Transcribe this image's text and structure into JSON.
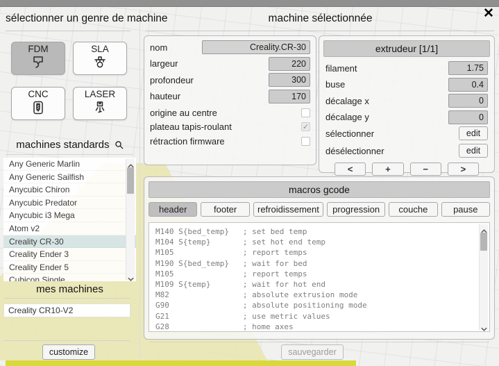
{
  "dialog": {
    "left_title": "sélectionner un genre de machine",
    "right_title": "machine sélectionnée",
    "close_icon": "✕"
  },
  "machine_types": [
    {
      "label": "FDM",
      "selected": true
    },
    {
      "label": "SLA",
      "selected": false
    },
    {
      "label": "CNC",
      "selected": false
    },
    {
      "label": "LASER",
      "selected": false
    }
  ],
  "standards": {
    "title": "machines standards",
    "items": [
      {
        "label": "Any Generic Marlin",
        "selected": false
      },
      {
        "label": "Any Generic Sailfish",
        "selected": false
      },
      {
        "label": "Anycubic Chiron",
        "selected": false
      },
      {
        "label": "Anycubic Predator",
        "selected": false
      },
      {
        "label": "Anycubic i3 Mega",
        "selected": false
      },
      {
        "label": "Atom v2",
        "selected": false
      },
      {
        "label": "Creality CR-30",
        "selected": true
      },
      {
        "label": "Creality Ender 3",
        "selected": false
      },
      {
        "label": "Creality Ender 5",
        "selected": false
      },
      {
        "label": "Cubicon Single",
        "selected": false
      }
    ]
  },
  "my_machines": {
    "title": "mes machines",
    "machine_name": "Creality CR10-V2"
  },
  "settings": {
    "name_label": "nom",
    "name_value": "Creality.CR-30",
    "width_label": "largeur",
    "width_value": "220",
    "depth_label": "profondeur",
    "depth_value": "300",
    "height_label": "hauteur",
    "height_value": "170",
    "origin_center_label": "origine au centre",
    "origin_center_checked": false,
    "belt_label": "plateau tapis-roulant",
    "belt_checked": true,
    "belt_disabled": true,
    "retract_label": "rétraction firmware",
    "retract_checked": false
  },
  "extruder": {
    "title": "extrudeur [1/1]",
    "filament_label": "filament",
    "filament_value": "1.75",
    "nozzle_label": "buse",
    "nozzle_value": "0.4",
    "offset_x_label": "décalage x",
    "offset_x_value": "0",
    "offset_y_label": "décalage y",
    "offset_y_value": "0",
    "select_label": "sélectionner",
    "select_button": "edit",
    "deselect_label": "désélectionner",
    "deselect_button": "edit",
    "nav": {
      "prev": "<",
      "add": "+",
      "remove": "−",
      "next": ">"
    }
  },
  "macros": {
    "title": "macros gcode",
    "tabs": [
      {
        "label": "header",
        "selected": true
      },
      {
        "label": "footer",
        "selected": false
      },
      {
        "label": "refroidissement",
        "selected": false
      },
      {
        "label": "progression",
        "selected": false
      },
      {
        "label": "couche",
        "selected": false
      },
      {
        "label": "pause",
        "selected": false
      }
    ],
    "code": "M140 S{bed_temp}   ; set bed temp\nM104 S{temp}       ; set hot end temp\nM105               ; report temps\nM190 S{bed_temp}   ; wait for bed\nM105               ; report temps\nM109 S{temp}       ; wait for hot end\nM82                ; absolute extrusion mode\nG90                ; absolute positioning mode\nG21                ; use metric values\nG28                ; home axes"
  },
  "footer": {
    "customize_label": "customize",
    "save_label": "sauvegarder",
    "save_disabled": true
  },
  "colors": {
    "selected_row": "#d7e5e5",
    "selected_button": "#b9b9b9",
    "header_bar": "#cbcbcb",
    "belt_yellow_pale": "#e9e6b2",
    "belt_yellow_bright": "#d9d93b",
    "topbar_gray": "#909090"
  }
}
